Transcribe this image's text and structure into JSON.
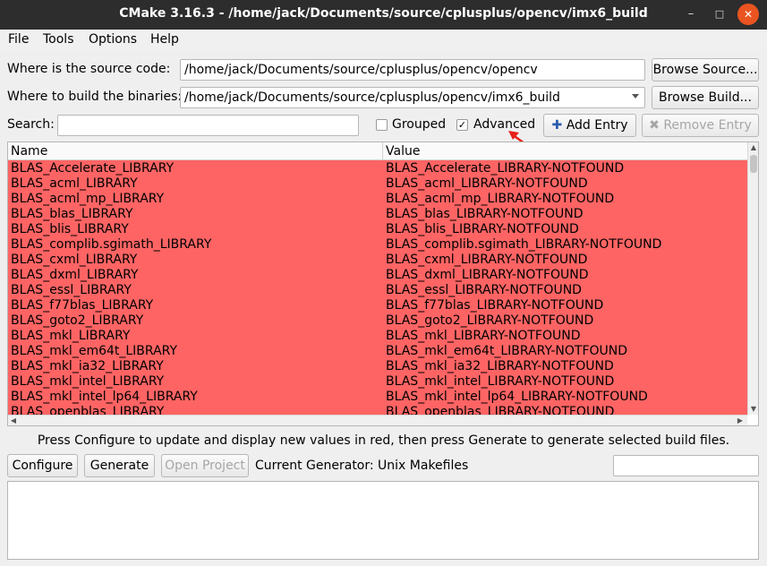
{
  "window": {
    "title": "CMake 3.16.3 - /home/jack/Documents/source/cplusplus/opencv/imx6_build",
    "min_glyph": "–",
    "max_glyph": "□",
    "close_glyph": "✕"
  },
  "menu": [
    "File",
    "Tools",
    "Options",
    "Help"
  ],
  "source": {
    "label": "Where is the source code:",
    "value": "/home/jack/Documents/source/cplusplus/opencv/opencv",
    "browse": "Browse Source..."
  },
  "build": {
    "label": "Where to build the binaries:",
    "value": "/home/jack/Documents/source/cplusplus/opencv/imx6_build",
    "browse": "Browse Build..."
  },
  "search": {
    "label": "Search:",
    "value": ""
  },
  "options": {
    "grouped_label": "Grouped",
    "grouped_checked": false,
    "advanced_label": "Advanced",
    "advanced_checked": true,
    "add_entry": "Add Entry",
    "remove_entry": "Remove Entry"
  },
  "table": {
    "columns": [
      "Name",
      "Value"
    ],
    "row_color": "#ff6464",
    "rows": [
      [
        "BLAS_Accelerate_LIBRARY",
        "BLAS_Accelerate_LIBRARY-NOTFOUND"
      ],
      [
        "BLAS_acml_LIBRARY",
        "BLAS_acml_LIBRARY-NOTFOUND"
      ],
      [
        "BLAS_acml_mp_LIBRARY",
        "BLAS_acml_mp_LIBRARY-NOTFOUND"
      ],
      [
        "BLAS_blas_LIBRARY",
        "BLAS_blas_LIBRARY-NOTFOUND"
      ],
      [
        "BLAS_blis_LIBRARY",
        "BLAS_blis_LIBRARY-NOTFOUND"
      ],
      [
        "BLAS_complib.sgimath_LIBRARY",
        "BLAS_complib.sgimath_LIBRARY-NOTFOUND"
      ],
      [
        "BLAS_cxml_LIBRARY",
        "BLAS_cxml_LIBRARY-NOTFOUND"
      ],
      [
        "BLAS_dxml_LIBRARY",
        "BLAS_dxml_LIBRARY-NOTFOUND"
      ],
      [
        "BLAS_essl_LIBRARY",
        "BLAS_essl_LIBRARY-NOTFOUND"
      ],
      [
        "BLAS_f77blas_LIBRARY",
        "BLAS_f77blas_LIBRARY-NOTFOUND"
      ],
      [
        "BLAS_goto2_LIBRARY",
        "BLAS_goto2_LIBRARY-NOTFOUND"
      ],
      [
        "BLAS_mkl_LIBRARY",
        "BLAS_mkl_LIBRARY-NOTFOUND"
      ],
      [
        "BLAS_mkl_em64t_LIBRARY",
        "BLAS_mkl_em64t_LIBRARY-NOTFOUND"
      ],
      [
        "BLAS_mkl_ia32_LIBRARY",
        "BLAS_mkl_ia32_LIBRARY-NOTFOUND"
      ],
      [
        "BLAS_mkl_intel_LIBRARY",
        "BLAS_mkl_intel_LIBRARY-NOTFOUND"
      ],
      [
        "BLAS_mkl_intel_lp64_LIBRARY",
        "BLAS_mkl_intel_lp64_LIBRARY-NOTFOUND"
      ],
      [
        "BLAS_openblas_LIBRARY",
        "BLAS_openblas_LIBRARY-NOTFOUND"
      ]
    ]
  },
  "status_message": "Press Configure to update and display new values in red, then press Generate to generate selected build files.",
  "actions": {
    "configure": "Configure",
    "generate": "Generate",
    "open_project": "Open Project",
    "generator": "Current Generator: Unix Makefiles"
  },
  "annotation_color": "#e8201a"
}
